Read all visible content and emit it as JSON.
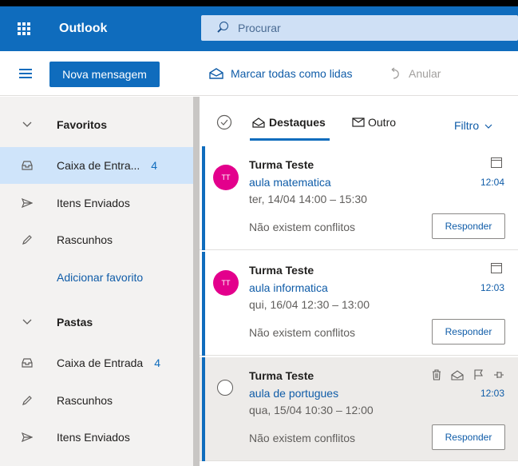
{
  "app": {
    "title": "Outlook"
  },
  "search": {
    "placeholder": "Procurar"
  },
  "toolbar": {
    "new_message": "Nova mensagem",
    "mark_all_read": "Marcar todas como lidas",
    "undo": "Anular"
  },
  "sidebar": {
    "favorites_header": "Favoritos",
    "fav_inbox": {
      "label": "Caixa de Entra...",
      "count": "4"
    },
    "fav_sent": "Itens Enviados",
    "fav_drafts": "Rascunhos",
    "add_favorite": "Adicionar favorito",
    "folders_header": "Pastas",
    "folder_inbox": {
      "label": "Caixa de Entrada",
      "count": "4"
    },
    "folder_drafts": "Rascunhos",
    "folder_sent": "Itens Enviados"
  },
  "list": {
    "tab_focused": "Destaques",
    "tab_other": "Outro",
    "filter": "Filtro",
    "messages": [
      {
        "avatar": "TT",
        "sender": "Turma Teste",
        "subject": "aula matematica",
        "when": "ter, 14/04 14:00 – 15:30",
        "conflict": "Não existem conflitos",
        "time": "12:04",
        "reply": "Responder"
      },
      {
        "avatar": "TT",
        "sender": "Turma Teste",
        "subject": "aula informatica",
        "when": "qui, 16/04 12:30 – 13:00",
        "conflict": "Não existem conflitos",
        "time": "12:03",
        "reply": "Responder"
      },
      {
        "avatar": "",
        "sender": "Turma Teste",
        "subject": "aula de portugues",
        "when": "qua, 15/04 10:30 – 12:00",
        "conflict": "Não existem conflitos",
        "time": "12:03",
        "reply": "Responder"
      }
    ]
  },
  "colors": {
    "brand": "#0f6cbd",
    "avatar": "#e3008c",
    "selected": "#cfe4fa"
  }
}
